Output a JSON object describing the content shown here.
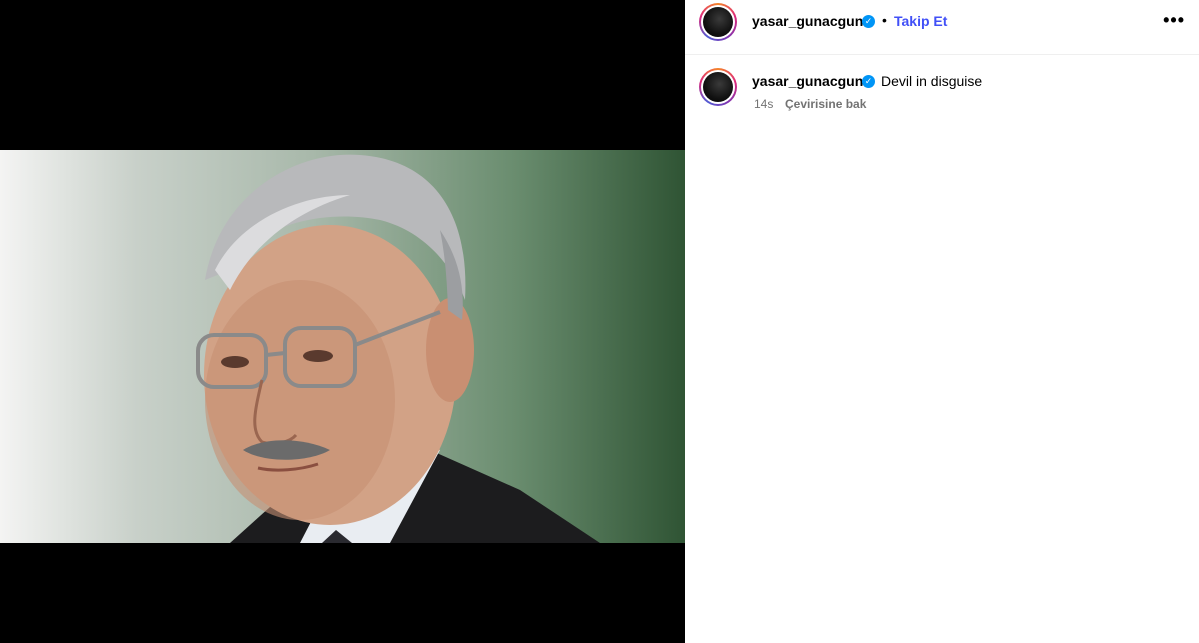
{
  "post": {
    "author": {
      "username": "yasar_gunacgun",
      "verified_icon": "verified-badge-icon"
    },
    "header": {
      "separator": "•",
      "follow_label": "Takip Et",
      "more_icon": "more-options-icon",
      "more_label": "•••"
    },
    "caption": {
      "username": "yasar_gunacgun",
      "text": "Devil in disguise",
      "time": "14s",
      "translate_label": "Çevirisine bak"
    }
  },
  "colors": {
    "follow": "#4150f7",
    "verified": "#0095f6",
    "muted": "#737373"
  }
}
